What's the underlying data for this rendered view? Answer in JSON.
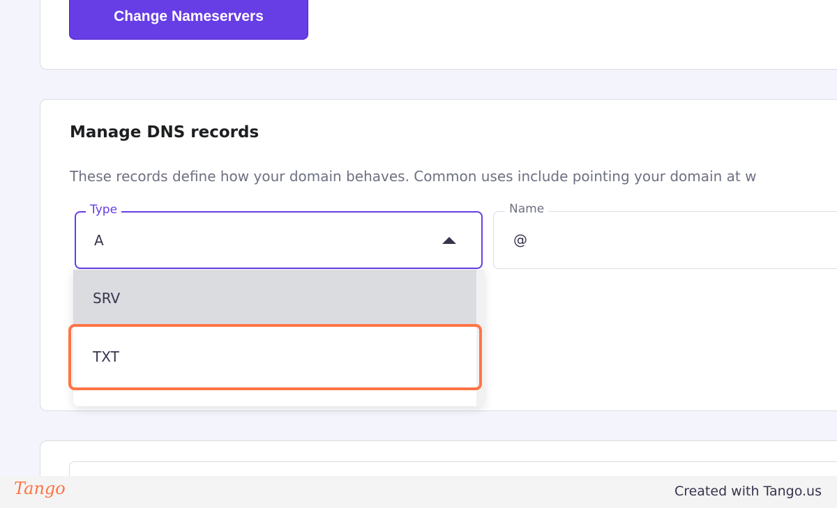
{
  "nameservers": {
    "change_button_label": "Change Nameservers"
  },
  "dns": {
    "title": "Manage DNS records",
    "description": "These records define how your domain behaves. Common uses include pointing your domain at w",
    "type_field": {
      "label": "Type",
      "value": "A"
    },
    "name_field": {
      "label": "Name",
      "value": "@"
    },
    "type_options": [
      {
        "label": "SRV"
      },
      {
        "label": "TXT"
      }
    ]
  },
  "footer": {
    "logo_text": "Tango",
    "credit": "Created with Tango.us"
  },
  "colors": {
    "accent": "#673de6",
    "highlight": "#ff7445",
    "hover_option_bg": "#dadce0"
  },
  "icons": {
    "type_dropdown_caret": "caret-up-icon"
  }
}
